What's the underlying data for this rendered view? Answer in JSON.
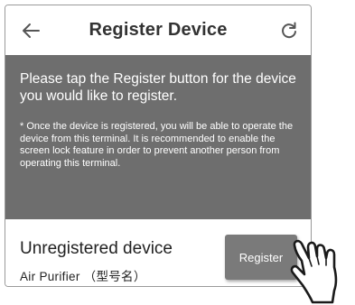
{
  "header": {
    "title": "Register Device",
    "back_icon": "arrow-left-icon",
    "refresh_icon": "refresh-icon"
  },
  "info": {
    "main_text": "Please tap the Register button for the device you would like to register.",
    "note_text": "* Once the device is registered, you will be able to operate the device from this terminal. It is recommended to enable the screen lock feature in order to prevent another person from operating this terminal."
  },
  "device": {
    "name": "Unregistered device",
    "model": "Air Purifier （型号名）",
    "register_label": "Register"
  },
  "colors": {
    "panel_bg": "#6e6e6e",
    "button_bg": "#7a7a7a",
    "text_dark": "#333333",
    "frame_border": "#9a9a9a"
  },
  "overlay": {
    "pointer_icon": "tapping-hand-icon"
  }
}
